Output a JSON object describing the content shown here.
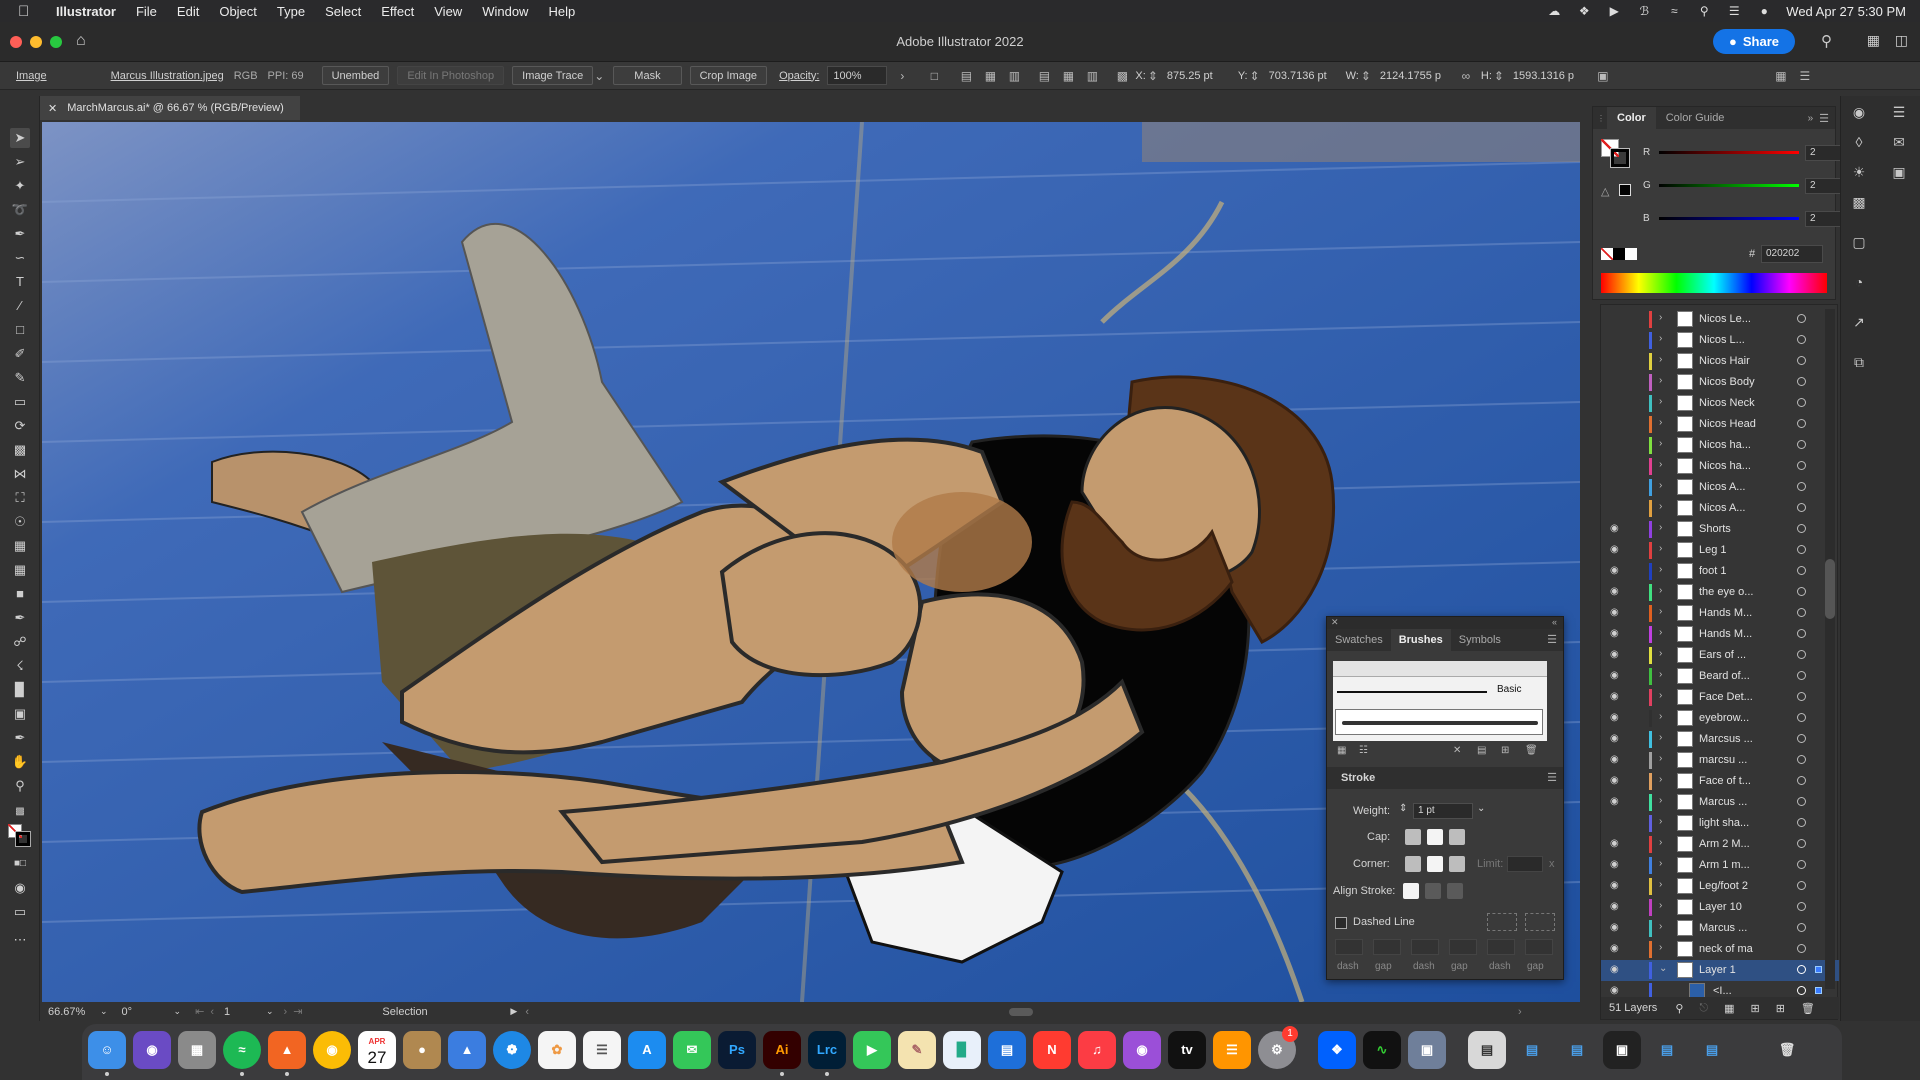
{
  "menubar": {
    "apple": "",
    "items": [
      "Illustrator",
      "File",
      "Edit",
      "Object",
      "Type",
      "Select",
      "Effect",
      "View",
      "Window",
      "Help"
    ],
    "datetime": "Wed Apr 27  5:30 PM"
  },
  "window": {
    "title": "Adobe Illustrator 2022",
    "share_label": "Share"
  },
  "controlbar": {
    "object_type": "Image",
    "file_name": "Marcus Illustration.jpeg",
    "color_mode": "RGB",
    "ppi": "PPI: 69",
    "unembed": "Unembed",
    "edit_photoshop": "Edit In Photoshop",
    "image_trace": "Image Trace",
    "mask": "Mask",
    "crop_image": "Crop Image",
    "opacity_label": "Opacity:",
    "opacity_value": "100%",
    "x_label": "X:",
    "x_value": "875.25 pt",
    "y_label": "Y:",
    "y_value": "703.7136 pt",
    "w_label": "W:",
    "w_value": "2124.1755 p",
    "h_label": "H:",
    "h_value": "1593.1316 p"
  },
  "document": {
    "tab_label": "MarchMarcus.ai* @ 66.67 % (RGB/Preview)"
  },
  "statusbar": {
    "zoom": "66.67%",
    "rotation": "0°",
    "artboard": "1",
    "tool": "Selection"
  },
  "color_panel": {
    "tabs": [
      "Color",
      "Color Guide"
    ],
    "r_label": "R",
    "r_value": "2",
    "g_label": "G",
    "g_value": "2",
    "b_label": "B",
    "b_value": "2",
    "hex_label": "#",
    "hex_value": "020202",
    "colors": {
      "red": "#e02020",
      "green": "#20c020",
      "blue": "#2040e0"
    }
  },
  "layers_panel": {
    "footer_count": "51 Layers",
    "layers": [
      {
        "name": "Nicos Le...",
        "visible": false,
        "color": "#e04040"
      },
      {
        "name": "Nicos L...",
        "visible": false,
        "color": "#4060e0"
      },
      {
        "name": "Nicos Hair",
        "visible": false,
        "color": "#e0d040"
      },
      {
        "name": "Nicos Body",
        "visible": false,
        "color": "#c060c0"
      },
      {
        "name": "Nicos Neck",
        "visible": false,
        "color": "#40c0c0"
      },
      {
        "name": "Nicos Head",
        "visible": false,
        "color": "#e07030"
      },
      {
        "name": "Nicos ha...",
        "visible": false,
        "color": "#80e040"
      },
      {
        "name": "Nicos ha...",
        "visible": false,
        "color": "#e04090"
      },
      {
        "name": "Nicos A...",
        "visible": false,
        "color": "#40a0e0"
      },
      {
        "name": "Nicos A...",
        "visible": false,
        "color": "#e0a040"
      },
      {
        "name": "Shorts",
        "visible": true,
        "color": "#9040e0"
      },
      {
        "name": "Leg 1",
        "visible": true,
        "color": "#e04040"
      },
      {
        "name": "foot 1",
        "visible": true,
        "color": "#2040c0"
      },
      {
        "name": "the eye o...",
        "visible": true,
        "color": "#40e080"
      },
      {
        "name": "Hands M...",
        "visible": true,
        "color": "#e06020"
      },
      {
        "name": "Hands M...",
        "visible": true,
        "color": "#c040e0"
      },
      {
        "name": "Ears of ...",
        "visible": true,
        "color": "#e0e040"
      },
      {
        "name": "Beard of...",
        "visible": true,
        "color": "#40c040"
      },
      {
        "name": "Face Det...",
        "visible": true,
        "color": "#e04060"
      },
      {
        "name": "eyebrow...",
        "visible": true,
        "color": "#303030"
      },
      {
        "name": "Marcsus ...",
        "visible": true,
        "color": "#40c0e0"
      },
      {
        "name": "marcsu ...",
        "visible": true,
        "color": "#a0a0a0"
      },
      {
        "name": "Face of t...",
        "visible": true,
        "color": "#e0a060"
      },
      {
        "name": "Marcus ...",
        "visible": true,
        "color": "#40e0a0"
      },
      {
        "name": "light sha...",
        "visible": false,
        "color": "#6060e0"
      },
      {
        "name": "Arm 2 M...",
        "visible": true,
        "color": "#e04040"
      },
      {
        "name": "Arm 1 m...",
        "visible": true,
        "color": "#4080e0"
      },
      {
        "name": "Leg/foot 2",
        "visible": true,
        "color": "#e0c040"
      },
      {
        "name": "Layer 10",
        "visible": true,
        "color": "#c040c0"
      },
      {
        "name": "Marcus ...",
        "visible": true,
        "color": "#40c0c0"
      },
      {
        "name": "neck of ma",
        "visible": true,
        "color": "#e07030"
      },
      {
        "name": "Layer 1",
        "visible": true,
        "color": "#4060e0",
        "selected": true
      },
      {
        "name": "<I...",
        "visible": true,
        "color": "#4060e0",
        "sub": true
      }
    ]
  },
  "float_panel": {
    "tabs": [
      "Swatches",
      "Brushes",
      "Symbols"
    ],
    "brush_basic": "Basic",
    "stroke_title": "Stroke",
    "weight_label": "Weight:",
    "weight_value": "1 pt",
    "cap_label": "Cap:",
    "corner_label": "Corner:",
    "limit_label": "Limit:",
    "limit_unit": "x",
    "align_label": "Align Stroke:",
    "dashed_label": "Dashed Line",
    "dash_labels": [
      "dash",
      "gap",
      "dash",
      "gap",
      "dash",
      "gap"
    ]
  },
  "dock": {
    "calendar_month": "APR",
    "calendar_day": "27",
    "photoshop": "Ps",
    "illustrator": "Ai",
    "lightroom": "Lrc",
    "appletv": "tv",
    "badge": "1"
  }
}
